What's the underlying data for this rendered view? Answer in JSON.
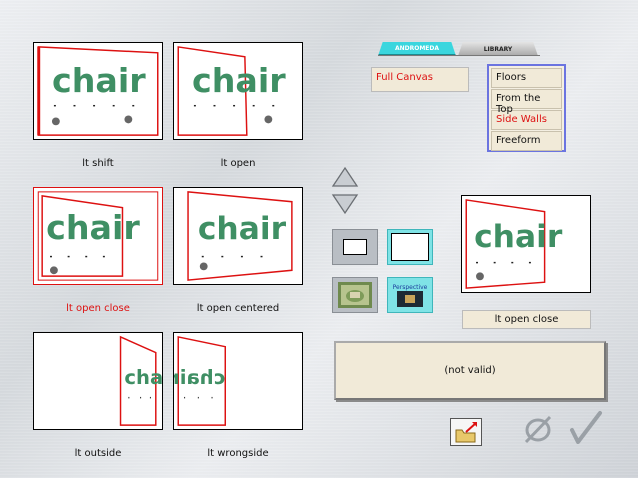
{
  "tabs": [
    {
      "label": "ANDROMEDA",
      "active": true
    },
    {
      "label": "LIBRARY",
      "active": false
    }
  ],
  "layouts": [
    {
      "caption": "lt shift",
      "selected": false,
      "brand": "chair"
    },
    {
      "caption": "lt open",
      "selected": false,
      "brand": "chair"
    },
    {
      "caption": "lt open close",
      "selected": true,
      "brand": "chair"
    },
    {
      "caption": "lt open centered",
      "selected": false,
      "brand": "chair"
    },
    {
      "caption": "lt outside",
      "selected": false,
      "brand": "chair"
    },
    {
      "caption": "lt wrongside",
      "selected": false,
      "brand": "chair"
    }
  ],
  "canvas_mode": "Full Canvas",
  "surface_menu": {
    "items": [
      "Floors",
      "From the Top",
      "Side Walls",
      "Freeform"
    ],
    "selected": "Side Walls"
  },
  "perspective_button_label": "Perspective",
  "preview": {
    "brand": "chair",
    "label": "lt open close"
  },
  "status": "(not valid)",
  "colors": {
    "accent_red": "#dd1111",
    "tab_cyan": "#3ad6de",
    "menu_border": "#6b74e0"
  },
  "icons": [
    "arrow-up-icon",
    "arrow-down-icon",
    "export-folder-icon",
    "cancel-icon",
    "confirm-check-icon"
  ]
}
